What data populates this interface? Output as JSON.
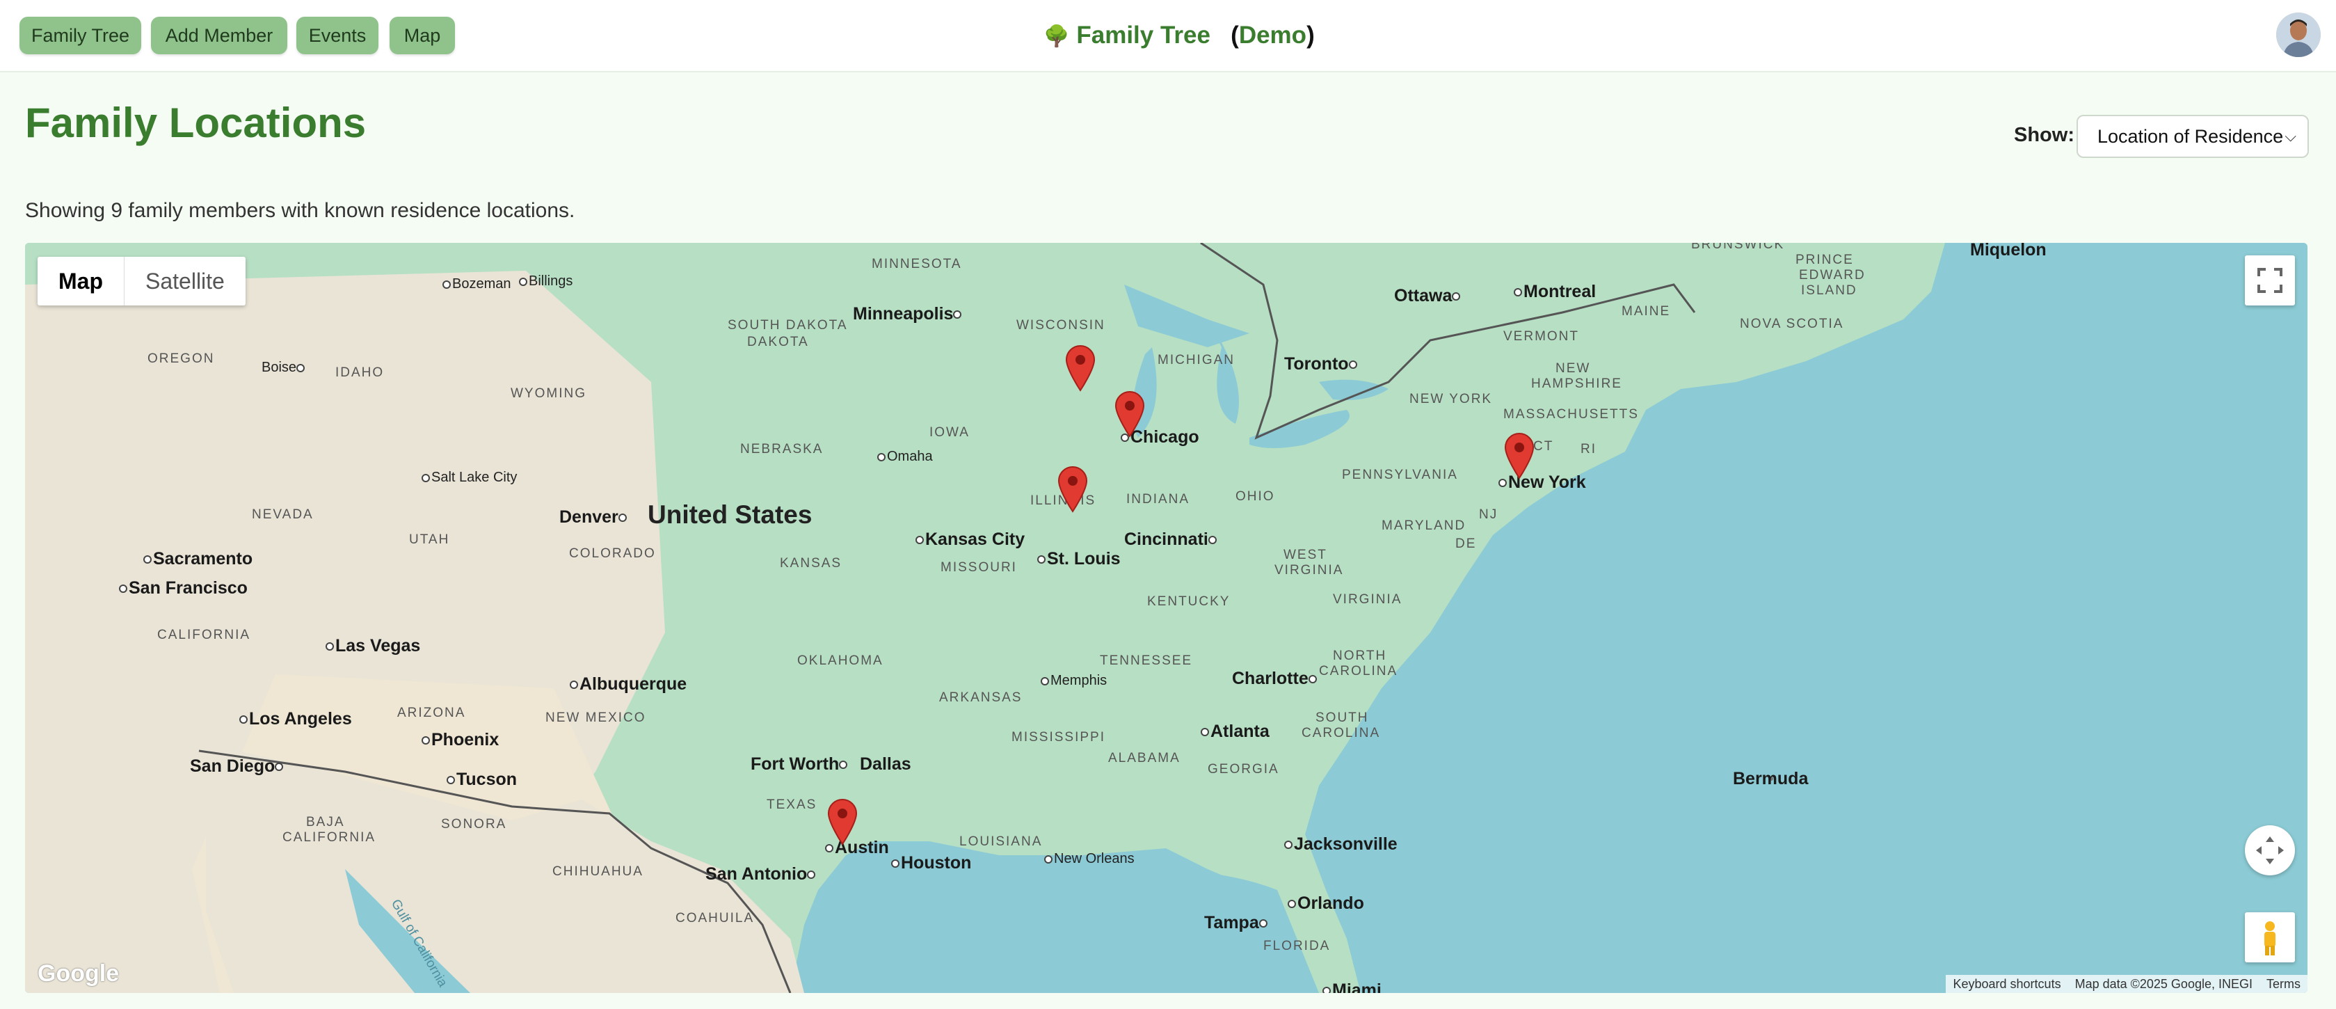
{
  "nav": {
    "family_tree": "Family Tree",
    "add_member": "Add Member",
    "events": "Events",
    "map": "Map"
  },
  "brand": {
    "icon": "🌳",
    "title": "Family Tree",
    "demo": "Demo"
  },
  "page": {
    "title": "Family Locations",
    "show_label": "Show:",
    "show_value": "Location of Residence",
    "count_text": "Showing 9 family members with known residence locations."
  },
  "map": {
    "type_map": "Map",
    "type_satellite": "Satellite",
    "country": "United States",
    "cities": {
      "chicago": "Chicago",
      "new_york": "New York",
      "austin": "Austin",
      "minneapolis": "Minneapolis",
      "toronto": "Toronto",
      "ottawa": "Ottawa",
      "montreal": "Montreal",
      "denver": "Denver",
      "kansas_city": "Kansas City",
      "st_louis": "St. Louis",
      "cincinnati": "Cincinnati",
      "omaha": "Omaha",
      "salt_lake": "Salt Lake City",
      "sacramento": "Sacramento",
      "san_francisco": "San Francisco",
      "las_vegas": "Las Vegas",
      "los_angeles": "Los Angeles",
      "san_diego": "San Diego",
      "phoenix": "Phoenix",
      "tucson": "Tucson",
      "albuquerque": "Albuquerque",
      "fort_worth": "Fort Worth",
      "dallas": "Dallas",
      "houston": "Houston",
      "san_antonio": "San Antonio",
      "memphis": "Memphis",
      "new_orleans": "New Orleans",
      "atlanta": "Atlanta",
      "charlotte": "Charlotte",
      "jacksonville": "Jacksonville",
      "orlando": "Orlando",
      "tampa": "Tampa",
      "miami": "Miami",
      "boise": "Boise",
      "bozeman": "Bozeman",
      "billings": "Billings",
      "bermuda": "Bermuda",
      "miquelon": "Miquelon"
    },
    "states": {
      "minnesota": "MINNESOTA",
      "wisconsin": "WISCONSIN",
      "michigan": "MICHIGAN",
      "south_dakota": "SOUTH DAKOTA",
      "oregon": "OREGON",
      "idaho": "IDAHO",
      "wyoming": "WYOMING",
      "nebraska": "NEBRASKA",
      "iowa": "IOWA",
      "illinois": "ILLINOIS",
      "indiana": "INDIANA",
      "ohio": "OHIO",
      "pennsylvania": "PENNSYLVANIA",
      "new_york": "NEW YORK",
      "vermont": "VERMONT",
      "maine": "MAINE",
      "new_hampshire": "NEW HAMPSHIRE",
      "massachusetts": "MASSACHUSETTS",
      "ct": "CT",
      "ri": "RI",
      "nj": "NJ",
      "de": "DE",
      "maryland": "MARYLAND",
      "nevada": "NEVADA",
      "utah": "UTAH",
      "colorado": "COLORADO",
      "kansas": "KANSAS",
      "missouri": "MISSOURI",
      "kentucky": "KENTUCKY",
      "west_virginia": "WEST VIRGINIA",
      "virginia": "VIRGINIA",
      "california": "CALIFORNIA",
      "arizona": "ARIZONA",
      "new_mexico": "NEW MEXICO",
      "oklahoma": "OKLAHOMA",
      "arkansas": "ARKANSAS",
      "tennessee": "TENNESSEE",
      "north_carolina": "NORTH CAROLINA",
      "south_carolina": "SOUTH CAROLINA",
      "mississippi": "MISSISSIPPI",
      "alabama": "ALABAMA",
      "georgia": "GEORGIA",
      "louisiana": "LOUISIANA",
      "texas": "TEXAS",
      "florida": "FLORIDA",
      "sonora": "SONORA",
      "chihuahua": "CHIHUAHUA",
      "coahuila": "COAHUILA",
      "baja": "BAJA",
      "baja2": "CALIFORNIA",
      "brunswick": "BRUNSWICK",
      "prince_edward": "PRINCE",
      "prince_edward2": "EDWARD",
      "prince_edward3": "ISLAND",
      "nova_scotia": "NOVA SCOTIA",
      "gulf": "Gulf of California"
    },
    "google": "Google",
    "keyboard": "Keyboard shortcuts",
    "map_data": "Map data ©2025 Google, INEGI",
    "terms": "Terms",
    "marker_count": 5
  },
  "colors": {
    "accent": "#3b7d2f",
    "nav_button": "#8fc38b",
    "marker": "#e03a31",
    "water": "#8ccbd5",
    "land": "#b9e0c6"
  }
}
